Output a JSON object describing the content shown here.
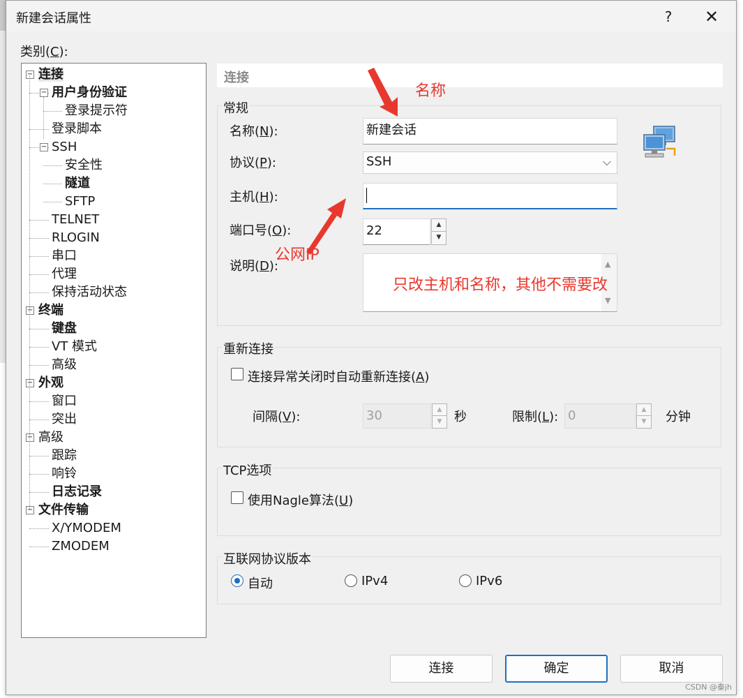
{
  "window": {
    "title": "新建会话属性",
    "help": "?",
    "close": "✕"
  },
  "category": {
    "label": "类别",
    "accel": "C",
    "suffix": "):",
    "prefix": "("
  },
  "tree": [
    {
      "label": "连接",
      "bold": true,
      "level": 0,
      "expander": "−",
      "selected": true
    },
    {
      "label": "用户身份验证",
      "bold": true,
      "level": 1,
      "expander": "−"
    },
    {
      "label": "登录提示符",
      "bold": false,
      "level": 2
    },
    {
      "label": "登录脚本",
      "bold": false,
      "level": 1
    },
    {
      "label": "SSH",
      "bold": false,
      "level": 1,
      "expander": "−"
    },
    {
      "label": "安全性",
      "bold": false,
      "level": 2
    },
    {
      "label": "隧道",
      "bold": true,
      "level": 2
    },
    {
      "label": "SFTP",
      "bold": false,
      "level": 2
    },
    {
      "label": "TELNET",
      "bold": false,
      "level": 1
    },
    {
      "label": "RLOGIN",
      "bold": false,
      "level": 1
    },
    {
      "label": "串口",
      "bold": false,
      "level": 1
    },
    {
      "label": "代理",
      "bold": false,
      "level": 1
    },
    {
      "label": "保持活动状态",
      "bold": false,
      "level": 1
    },
    {
      "label": "终端",
      "bold": true,
      "level": 0,
      "expander": "−"
    },
    {
      "label": "键盘",
      "bold": true,
      "level": 1
    },
    {
      "label": "VT 模式",
      "bold": false,
      "level": 1
    },
    {
      "label": "高级",
      "bold": false,
      "level": 1
    },
    {
      "label": "外观",
      "bold": true,
      "level": 0,
      "expander": "−"
    },
    {
      "label": "窗口",
      "bold": false,
      "level": 1
    },
    {
      "label": "突出",
      "bold": false,
      "level": 1
    },
    {
      "label": "高级",
      "bold": false,
      "level": 0,
      "expander": "−"
    },
    {
      "label": "跟踪",
      "bold": false,
      "level": 1
    },
    {
      "label": "响铃",
      "bold": false,
      "level": 1
    },
    {
      "label": "日志记录",
      "bold": true,
      "level": 1
    },
    {
      "label": "文件传输",
      "bold": true,
      "level": 0,
      "expander": "−"
    },
    {
      "label": "X/YMODEM",
      "bold": false,
      "level": 1
    },
    {
      "label": "ZMODEM",
      "bold": false,
      "level": 1
    }
  ],
  "panel": {
    "header": "连接",
    "general": {
      "title": "常规",
      "name_label": "名称",
      "name_accel": "N",
      "name_value": "新建会话",
      "protocol_label": "协议",
      "protocol_accel": "P",
      "protocol_value": "SSH",
      "host_label": "主机",
      "host_accel": "H",
      "host_value": "",
      "port_label": "端口号",
      "port_accel": "O",
      "port_value": "22",
      "desc_label": "说明",
      "desc_accel": "D",
      "desc_value": ""
    },
    "reconnect": {
      "title": "重新连接",
      "checkbox_label": "连接异常关闭时自动重新连接(",
      "checkbox_accel": "A",
      "interval_label": "间隔",
      "interval_accel": "V",
      "interval_value": "30",
      "seconds": "秒",
      "limit_label": "限制",
      "limit_accel": "L",
      "limit_value": "0",
      "minutes": "分钟"
    },
    "tcp": {
      "title": "TCP选项",
      "nagle_label": "使用Nagle算法(",
      "nagle_accel": "U"
    },
    "ipver": {
      "title": "互联网协议版本",
      "options": [
        "自动",
        "IPv4",
        "IPv6"
      ],
      "selected": "自动"
    }
  },
  "buttons": {
    "connect": "连接",
    "ok": "确定",
    "cancel": "取消"
  },
  "annotations": {
    "name": "名称",
    "public_ip": "公网IP",
    "note": "只改主机和名称，其他不需要改",
    "color": "#e8382d"
  },
  "watermark": "CSDN @秦jh",
  "accent": "#1f6fbf"
}
